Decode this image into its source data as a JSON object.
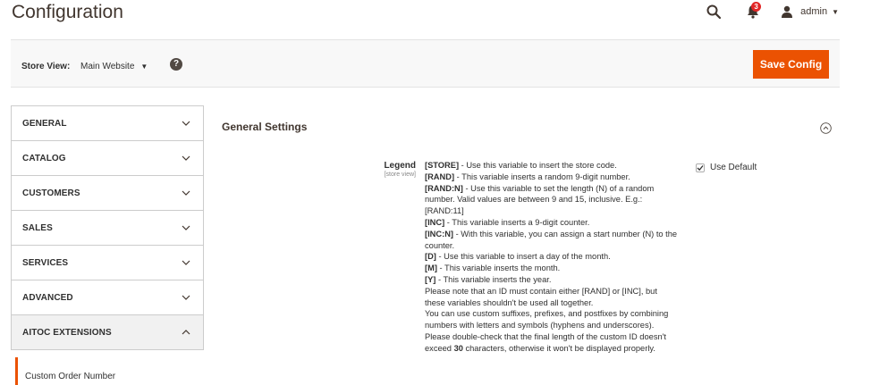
{
  "page": {
    "title": "Configuration"
  },
  "header": {
    "notification_count": "3",
    "user_name": "admin"
  },
  "store_switcher": {
    "label": "Store View:",
    "selected": "Main Website"
  },
  "actions": {
    "save_label": "Save Config"
  },
  "colors": {
    "accent": "#eb5202",
    "badge": "#e22626"
  },
  "sidebar": {
    "items": [
      {
        "label": "GENERAL",
        "icon": "chevron-down-icon"
      },
      {
        "label": "CATALOG",
        "icon": "chevron-down-icon"
      },
      {
        "label": "CUSTOMERS",
        "icon": "chevron-down-icon"
      },
      {
        "label": "SALES",
        "icon": "chevron-down-icon"
      },
      {
        "label": "SERVICES",
        "icon": "chevron-down-icon"
      },
      {
        "label": "ADVANCED",
        "icon": "chevron-down-icon"
      },
      {
        "label": "AITOC EXTENSIONS",
        "icon": "chevron-up-icon"
      }
    ],
    "sub_item": "Custom Order Number"
  },
  "section": {
    "title": "General Settings",
    "field": {
      "label": "Legend",
      "scope": "[store view]",
      "use_default_label": "Use Default",
      "use_default_checked": true,
      "legend": [
        {
          "code": "[STORE]",
          "text": " - Use this variable to insert the store code."
        },
        {
          "code": "[RAND]",
          "text": " - This variable inserts a random 9-digit number."
        },
        {
          "code": "[RAND:N]",
          "text": " - Use this variable to set the length (N) of a random number. Valid values are between 9 and 15, inclusive. E.g.: [RAND:11]"
        },
        {
          "code": "[INC]",
          "text": " - This variable inserts a 9-digit counter."
        },
        {
          "code": "[INC:N]",
          "text": " - With this variable, you can assign a start number (N) to the counter."
        },
        {
          "code": "[D]",
          "text": " - Use this variable to insert a day of the month."
        },
        {
          "code": "[M]",
          "text": " - This variable inserts the month."
        },
        {
          "code": "[Y]",
          "text": " - This variable inserts the year."
        }
      ],
      "note_1": "Please note that an ID must contain either [RAND] or [INC], but these variables shouldn't be used all together.",
      "note_2": "You can use custom suffixes, prefixes, and postfixes by combining numbers with letters and symbols (hyphens and underscores).",
      "note_3_before": "Please double-check that the final length of the custom ID doesn't exceed ",
      "note_3_bold": "30",
      "note_3_after": " characters, otherwise it won't be displayed properly."
    }
  }
}
